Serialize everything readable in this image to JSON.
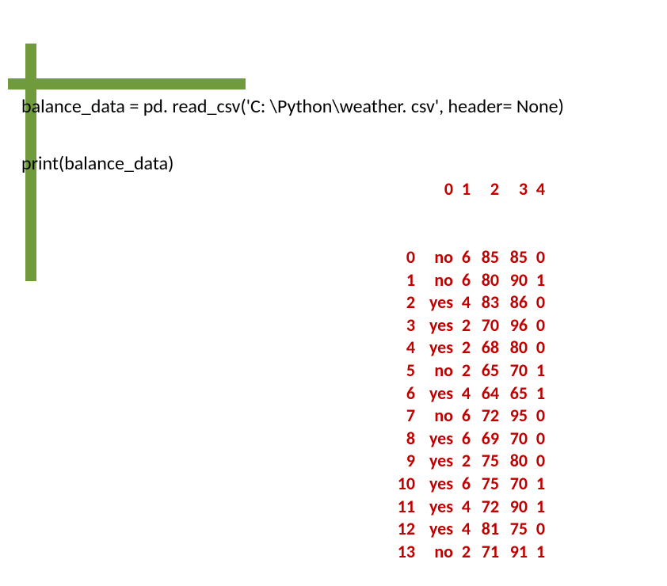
{
  "code": {
    "line1": "balance_data = pd. read_csv('C: \\Python\\weather. csv', header= None)",
    "line2": "print(balance_data)"
  },
  "output": {
    "header": {
      "idx": "",
      "c0": "0",
      "c1": "1",
      "c2": "2",
      "c3": "3",
      "c4": "4"
    },
    "rows": [
      {
        "idx": "0",
        "c0": "no",
        "c1": "6",
        "c2": "85",
        "c3": "85",
        "c4": "0"
      },
      {
        "idx": "1",
        "c0": "no",
        "c1": "6",
        "c2": "80",
        "c3": "90",
        "c4": "1"
      },
      {
        "idx": "2",
        "c0": "yes",
        "c1": "4",
        "c2": "83",
        "c3": "86",
        "c4": "0"
      },
      {
        "idx": "3",
        "c0": "yes",
        "c1": "2",
        "c2": "70",
        "c3": "96",
        "c4": "0"
      },
      {
        "idx": "4",
        "c0": "yes",
        "c1": "2",
        "c2": "68",
        "c3": "80",
        "c4": "0"
      },
      {
        "idx": "5",
        "c0": "no",
        "c1": "2",
        "c2": "65",
        "c3": "70",
        "c4": "1"
      },
      {
        "idx": "6",
        "c0": "yes",
        "c1": "4",
        "c2": "64",
        "c3": "65",
        "c4": "1"
      },
      {
        "idx": "7",
        "c0": "no",
        "c1": "6",
        "c2": "72",
        "c3": "95",
        "c4": "0"
      },
      {
        "idx": "8",
        "c0": "yes",
        "c1": "6",
        "c2": "69",
        "c3": "70",
        "c4": "0"
      },
      {
        "idx": "9",
        "c0": "yes",
        "c1": "2",
        "c2": "75",
        "c3": "80",
        "c4": "0"
      },
      {
        "idx": "10",
        "c0": "yes",
        "c1": "6",
        "c2": "75",
        "c3": "70",
        "c4": "1"
      },
      {
        "idx": "11",
        "c0": "yes",
        "c1": "4",
        "c2": "72",
        "c3": "90",
        "c4": "1"
      },
      {
        "idx": "12",
        "c0": "yes",
        "c1": "4",
        "c2": "81",
        "c3": "75",
        "c4": "0"
      },
      {
        "idx": "13",
        "c0": "no",
        "c1": "2",
        "c2": "71",
        "c3": "91",
        "c4": "1"
      }
    ]
  }
}
